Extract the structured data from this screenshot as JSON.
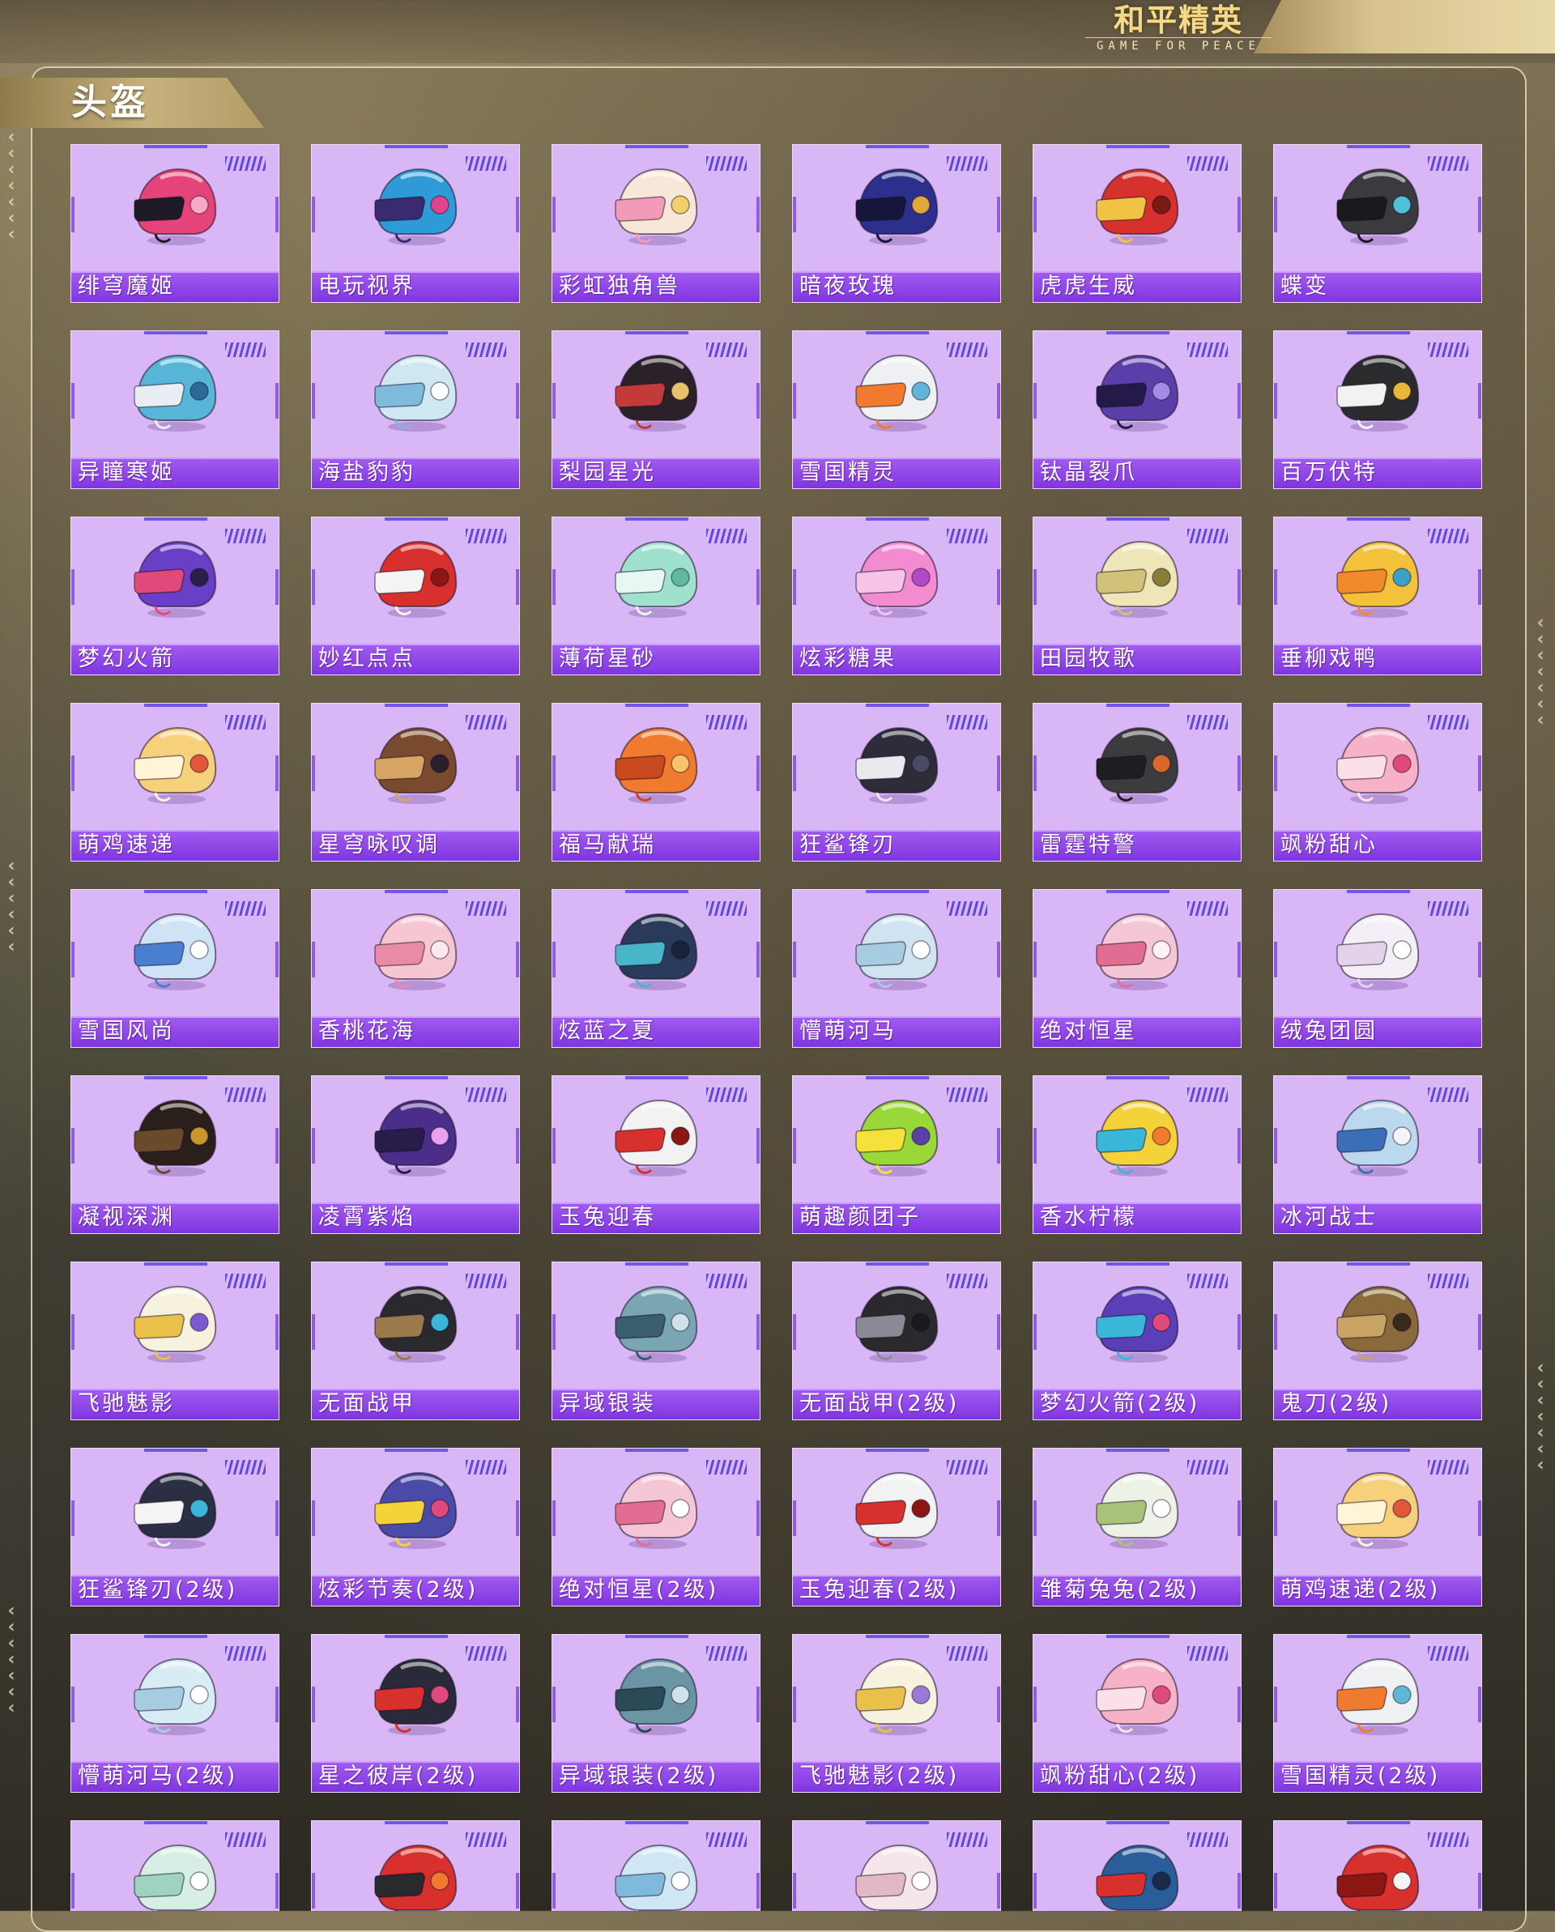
{
  "brand": {
    "logo_main": "和平精英",
    "logo_sub": "GAME FOR PEACE"
  },
  "section": {
    "title": "头盔"
  },
  "helmets": [
    {
      "name": "绯穹魔姬",
      "colors": [
        "#e4447a",
        "#1e1b26",
        "#f7a9c6"
      ]
    },
    {
      "name": "电玩视界",
      "colors": [
        "#2e9ad8",
        "#3a2a70",
        "#e3438a"
      ]
    },
    {
      "name": "彩虹独角兽",
      "colors": [
        "#f7e7d8",
        "#f39ab8",
        "#f2cf6a"
      ]
    },
    {
      "name": "暗夜玫瑰",
      "colors": [
        "#2c2f8c",
        "#16163a",
        "#e0a83a"
      ]
    },
    {
      "name": "虎虎生威",
      "colors": [
        "#d6312d",
        "#f2c244",
        "#7a1a15"
      ]
    },
    {
      "name": "蝶变",
      "colors": [
        "#3a3a3f",
        "#1a1a1e",
        "#4fc1d9"
      ]
    },
    {
      "name": "异瞳寒姬",
      "colors": [
        "#57b6d8",
        "#e8eef2",
        "#2c6b96"
      ]
    },
    {
      "name": "海盐豹豹",
      "colors": [
        "#cfe7f2",
        "#7fb9db",
        "#ffffff"
      ]
    },
    {
      "name": "梨园星光",
      "colors": [
        "#2a2228",
        "#c33a3a",
        "#e8c26a"
      ]
    },
    {
      "name": "雪国精灵",
      "colors": [
        "#eef0f2",
        "#f07a2e",
        "#5fb6d6"
      ]
    },
    {
      "name": "钛晶裂爪",
      "colors": [
        "#5b3fa8",
        "#241a4a",
        "#a58ae6"
      ]
    },
    {
      "name": "百万伏特",
      "colors": [
        "#2b2b2e",
        "#f2f2f2",
        "#e9b83a"
      ]
    },
    {
      "name": "梦幻火箭",
      "colors": [
        "#6a3fc7",
        "#e04a7a",
        "#2a1e4a"
      ]
    },
    {
      "name": "妙红点点",
      "colors": [
        "#d8302c",
        "#f4f4f4",
        "#8b1612"
      ]
    },
    {
      "name": "薄荷星砂",
      "colors": [
        "#9fe0cf",
        "#e7f7f1",
        "#5fb9a2"
      ]
    },
    {
      "name": "炫彩糖果",
      "colors": [
        "#f28bd0",
        "#f6c4e6",
        "#b24ac8"
      ]
    },
    {
      "name": "田园牧歌",
      "colors": [
        "#efe6b8",
        "#d1c27a",
        "#8a7d3a"
      ]
    },
    {
      "name": "垂柳戏鸭",
      "colors": [
        "#f4c23a",
        "#f08a2a",
        "#3aa0c8"
      ]
    },
    {
      "name": "萌鸡速递",
      "colors": [
        "#f6d07a",
        "#fff4d6",
        "#e2563a"
      ]
    },
    {
      "name": "星穹咏叹调",
      "colors": [
        "#7a4a2e",
        "#d7a564",
        "#2a1f2a"
      ]
    },
    {
      "name": "福马献瑞",
      "colors": [
        "#f07a2e",
        "#c94a1e",
        "#f7c26a"
      ]
    },
    {
      "name": "狂鲨锋刃",
      "colors": [
        "#2d2d3a",
        "#e9e9ee",
        "#4a4a66"
      ]
    },
    {
      "name": "雷霆特警",
      "colors": [
        "#3a3c3e",
        "#1e1f20",
        "#d9682a"
      ]
    },
    {
      "name": "飒粉甜心",
      "colors": [
        "#f7b2c8",
        "#fbe0ea",
        "#e04a7a"
      ]
    },
    {
      "name": "雪国风尚",
      "colors": [
        "#cfe3f6",
        "#4a7fd0",
        "#ffffff"
      ]
    },
    {
      "name": "香桃花海",
      "colors": [
        "#f6c6d2",
        "#e98aa6",
        "#fbe9ee"
      ]
    },
    {
      "name": "炫蓝之夏",
      "colors": [
        "#2a3a5a",
        "#48b6c8",
        "#1a2238"
      ]
    },
    {
      "name": "懵萌河马",
      "colors": [
        "#cfe4f0",
        "#a7cbe0",
        "#ffffff"
      ]
    },
    {
      "name": "绝对恒星",
      "colors": [
        "#f4c6d6",
        "#e26d92",
        "#fff1f5"
      ]
    },
    {
      "name": "绒兔团圆",
      "colors": [
        "#f4eef6",
        "#e3d3ea",
        "#ffffff"
      ]
    },
    {
      "name": "凝视深渊",
      "colors": [
        "#2b1f1c",
        "#6a4a2a",
        "#c9962e"
      ]
    },
    {
      "name": "凌霄紫焰",
      "colors": [
        "#4a2e8a",
        "#2a1c4a",
        "#e8a2f0"
      ]
    },
    {
      "name": "玉兔迎春",
      "colors": [
        "#f2f2f2",
        "#d8302c",
        "#8b1612"
      ]
    },
    {
      "name": "萌趣颜团子",
      "colors": [
        "#9ad83a",
        "#f4e23a",
        "#5a3fa8"
      ]
    },
    {
      "name": "香水柠檬",
      "colors": [
        "#f4d23a",
        "#39b6d8",
        "#f07a2e"
      ]
    },
    {
      "name": "冰河战士",
      "colors": [
        "#bcd8ee",
        "#3a6fb8",
        "#f4f4f4"
      ]
    },
    {
      "name": "飞驰魅影",
      "colors": [
        "#f7f2de",
        "#e8c04a",
        "#7a5ad0"
      ]
    },
    {
      "name": "无面战甲",
      "colors": [
        "#2a2a2e",
        "#9a7a4a",
        "#39b6d8"
      ]
    },
    {
      "name": "异域银装",
      "colors": [
        "#7aa6b4",
        "#3a5e6e",
        "#cfe2e8"
      ]
    },
    {
      "name": "无面战甲(2级)",
      "colors": [
        "#2a2a2e",
        "#8a8a96",
        "#1a1a1e"
      ]
    },
    {
      "name": "梦幻火箭(2级)",
      "colors": [
        "#5a3fb8",
        "#39b6d8",
        "#e04a7a"
      ]
    },
    {
      "name": "鬼刀(2级)",
      "colors": [
        "#8a6a3a",
        "#c9a464",
        "#3a2a1a"
      ]
    },
    {
      "name": "狂鲨锋刃(2级)",
      "colors": [
        "#2a2f44",
        "#f4f4f4",
        "#39b6d8"
      ]
    },
    {
      "name": "炫彩节奏(2级)",
      "colors": [
        "#4a4aa8",
        "#f4d23a",
        "#e04a7a"
      ]
    },
    {
      "name": "绝对恒星(2级)",
      "colors": [
        "#f4c6d6",
        "#e26d92",
        "#ffffff"
      ]
    },
    {
      "name": "玉兔迎春(2级)",
      "colors": [
        "#f2f2f2",
        "#d8302c",
        "#8b1612"
      ]
    },
    {
      "name": "雏菊兔兔(2级)",
      "colors": [
        "#eef2e6",
        "#a8c27a",
        "#ffffff"
      ]
    },
    {
      "name": "萌鸡速递(2级)",
      "colors": [
        "#f6d07a",
        "#fff4d6",
        "#e2563a"
      ]
    },
    {
      "name": "懵萌河马(2级)",
      "colors": [
        "#d7ecf4",
        "#a7cbe0",
        "#ffffff"
      ]
    },
    {
      "name": "星之彼岸(2级)",
      "colors": [
        "#2a2a3a",
        "#d8302c",
        "#e04a7a"
      ]
    },
    {
      "name": "异域银装(2级)",
      "colors": [
        "#6a96a4",
        "#2a4a56",
        "#cfe2e8"
      ]
    },
    {
      "name": "飞驰魅影(2级)",
      "colors": [
        "#f7f2de",
        "#e8c04a",
        "#9a7ad8"
      ]
    },
    {
      "name": "飒粉甜心(2级)",
      "colors": [
        "#f7b2c8",
        "#fbe0ea",
        "#e04a7a"
      ]
    },
    {
      "name": "雪国精灵(2级)",
      "colors": [
        "#eef0f2",
        "#f07a2e",
        "#5fb6d6"
      ]
    },
    {
      "name": "",
      "colors": [
        "#d6eee4",
        "#9fd2c0",
        "#ffffff"
      ]
    },
    {
      "name": "",
      "colors": [
        "#d8302c",
        "#2a2a2e",
        "#f07a2e"
      ]
    },
    {
      "name": "",
      "colors": [
        "#cfe6f4",
        "#7fb9db",
        "#ffffff"
      ]
    },
    {
      "name": "",
      "colors": [
        "#f4e6ea",
        "#e3b8c6",
        "#ffffff"
      ]
    },
    {
      "name": "",
      "colors": [
        "#2a5e9a",
        "#d8302c",
        "#1a2a4a"
      ]
    },
    {
      "name": "",
      "colors": [
        "#d8302c",
        "#8b1612",
        "#f4f4f4"
      ]
    }
  ]
}
